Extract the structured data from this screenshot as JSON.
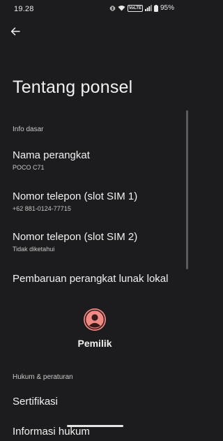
{
  "status_bar": {
    "time": "19.28",
    "volte": "VoLTE",
    "battery": "95%"
  },
  "header": {
    "title": "Tentang ponsel"
  },
  "sections": {
    "basic_info": "Info dasar",
    "legal": "Hukum & peraturan"
  },
  "items": {
    "device_name": {
      "title": "Nama perangkat",
      "subtitle": "POCO C71"
    },
    "phone_sim1": {
      "title": "Nomor telepon (slot SIM 1)",
      "subtitle": "+62 881-0124-77715"
    },
    "phone_sim2": {
      "title": "Nomor telepon (slot SIM 2)",
      "subtitle": "Tidak diketahui"
    },
    "local_update": {
      "title": "Pembaruan perangkat lunak lokal"
    },
    "certification": {
      "title": "Sertifikasi"
    },
    "legal_info": {
      "title": "Informasi hukum"
    }
  },
  "owner": {
    "label": "Pemilik"
  },
  "colors": {
    "background": "#1c1c1e",
    "avatar": "#f08a84",
    "text_primary": "#f1f1f1",
    "text_secondary": "#c8c8c8"
  }
}
